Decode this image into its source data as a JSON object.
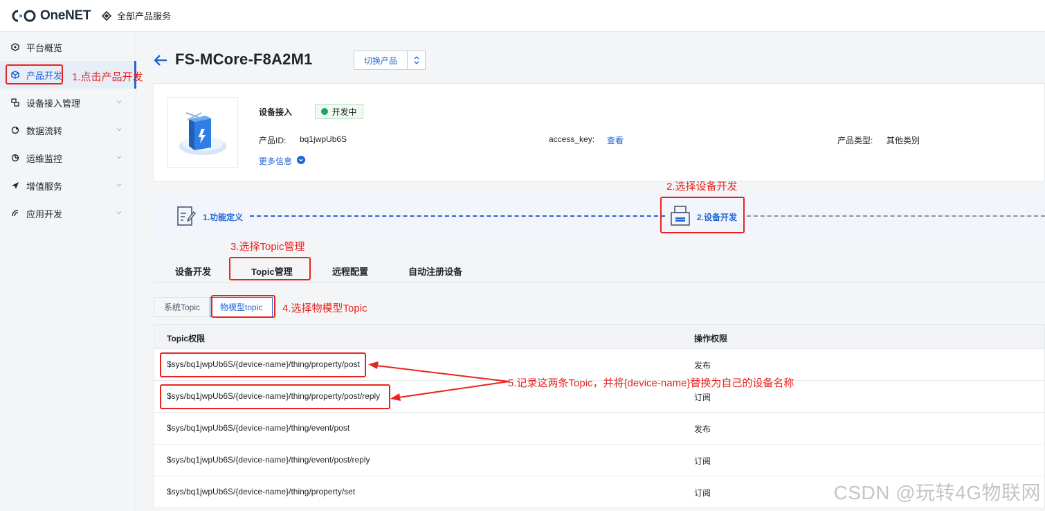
{
  "header": {
    "logo_text": "OneNET",
    "all_products": "全部产品服务"
  },
  "sidebar": {
    "items": [
      {
        "label": "平台概览"
      },
      {
        "label": "产品开发"
      },
      {
        "label": "设备接入管理"
      },
      {
        "label": "数据流转"
      },
      {
        "label": "运维监控"
      },
      {
        "label": "增值服务"
      },
      {
        "label": "应用开发"
      }
    ]
  },
  "product": {
    "name": "FS-MCore-F8A2M1",
    "switch_label": "切换产品",
    "access_label": "设备接入",
    "status": "开发中",
    "id_label": "产品ID:",
    "id_value": "bq1jwpUb6S",
    "access_key_label": "access_key:",
    "access_key_link": "查看",
    "type_label": "产品类型:",
    "type_value": "其他类别",
    "more_info": "更多信息"
  },
  "steps": {
    "step1": "1.功能定义",
    "step2": "2.设备开发"
  },
  "tabs": [
    "设备开发",
    "Topic管理",
    "远程配置",
    "自动注册设备"
  ],
  "subtabs": [
    "系统Topic",
    "物模型topic"
  ],
  "table": {
    "headers": [
      "Topic权限",
      "操作权限"
    ],
    "rows": [
      {
        "topic": "$sys/bq1jwpUb6S/{device-name}/thing/property/post",
        "perm": "发布"
      },
      {
        "topic": "$sys/bq1jwpUb6S/{device-name}/thing/property/post/reply",
        "perm": "订阅"
      },
      {
        "topic": "$sys/bq1jwpUb6S/{device-name}/thing/event/post",
        "perm": "发布"
      },
      {
        "topic": "$sys/bq1jwpUb6S/{device-name}/thing/event/post/reply",
        "perm": "订阅"
      },
      {
        "topic": "$sys/bq1jwpUb6S/{device-name}/thing/property/set",
        "perm": "订阅"
      }
    ]
  },
  "annotations": {
    "a1": "1.点击产品开发",
    "a2": "2.选择设备开发",
    "a3": "3.选择Topic管理",
    "a4": "4.选择物模型Topic",
    "a5": "5.记录这两条Topic，并将{device-name}替换为自己的设备名称"
  },
  "watermark": "CSDN @玩转4G物联网",
  "colors": {
    "accent": "#1f65d6",
    "annotation": "#e8231d",
    "status_green": "#21a35a"
  }
}
